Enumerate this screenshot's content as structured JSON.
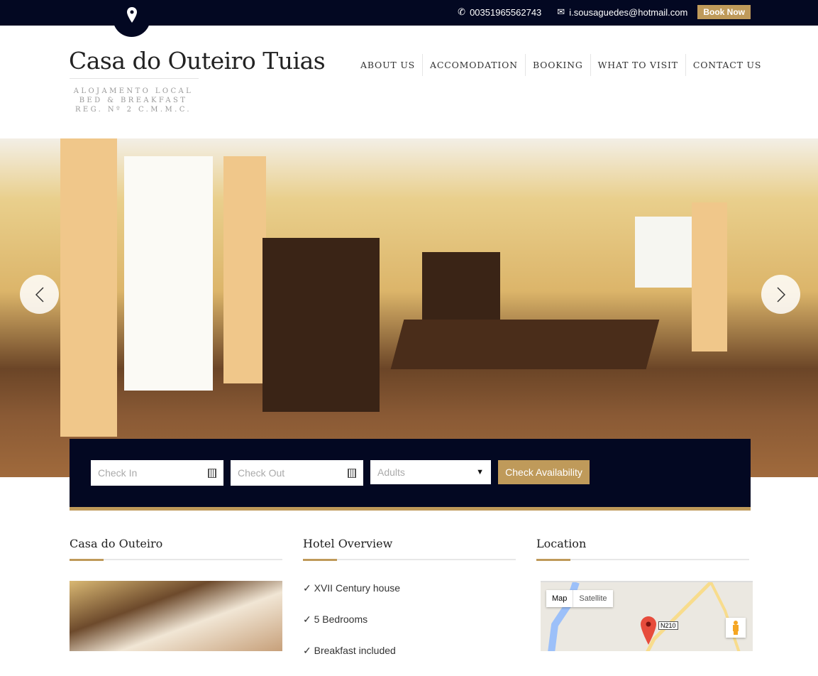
{
  "topbar": {
    "phone": "00351965562743",
    "email": "i.sousaguedes@hotmail.com",
    "book_now": "Book Now"
  },
  "brand": {
    "title": "Casa do Outeiro Tuias",
    "tagline": [
      "ALOJAMENTO LOCAL",
      "BED & BREAKFAST",
      "REG. Nº 2 C.M.M.C."
    ]
  },
  "nav": [
    "ABOUT US",
    "ACCOMODATION",
    "BOOKING",
    "WHAT TO VISIT",
    "CONTACT US"
  ],
  "booking": {
    "check_in_placeholder": "Check In",
    "check_out_placeholder": "Check Out",
    "adults_placeholder": "Adults",
    "submit": "Check Availability"
  },
  "sections": {
    "about": {
      "title": "Casa do Outeiro"
    },
    "overview": {
      "title": "Hotel Overview",
      "items": [
        "✓ XVII Century house",
        "✓ 5 Bedrooms",
        "✓ Breakfast included"
      ]
    },
    "location": {
      "title": "Location",
      "map_tab": "Map",
      "satellite_tab": "Satellite",
      "road_label": "N210"
    }
  },
  "colors": {
    "navy": "#030822",
    "gold": "#bf9a5a"
  }
}
